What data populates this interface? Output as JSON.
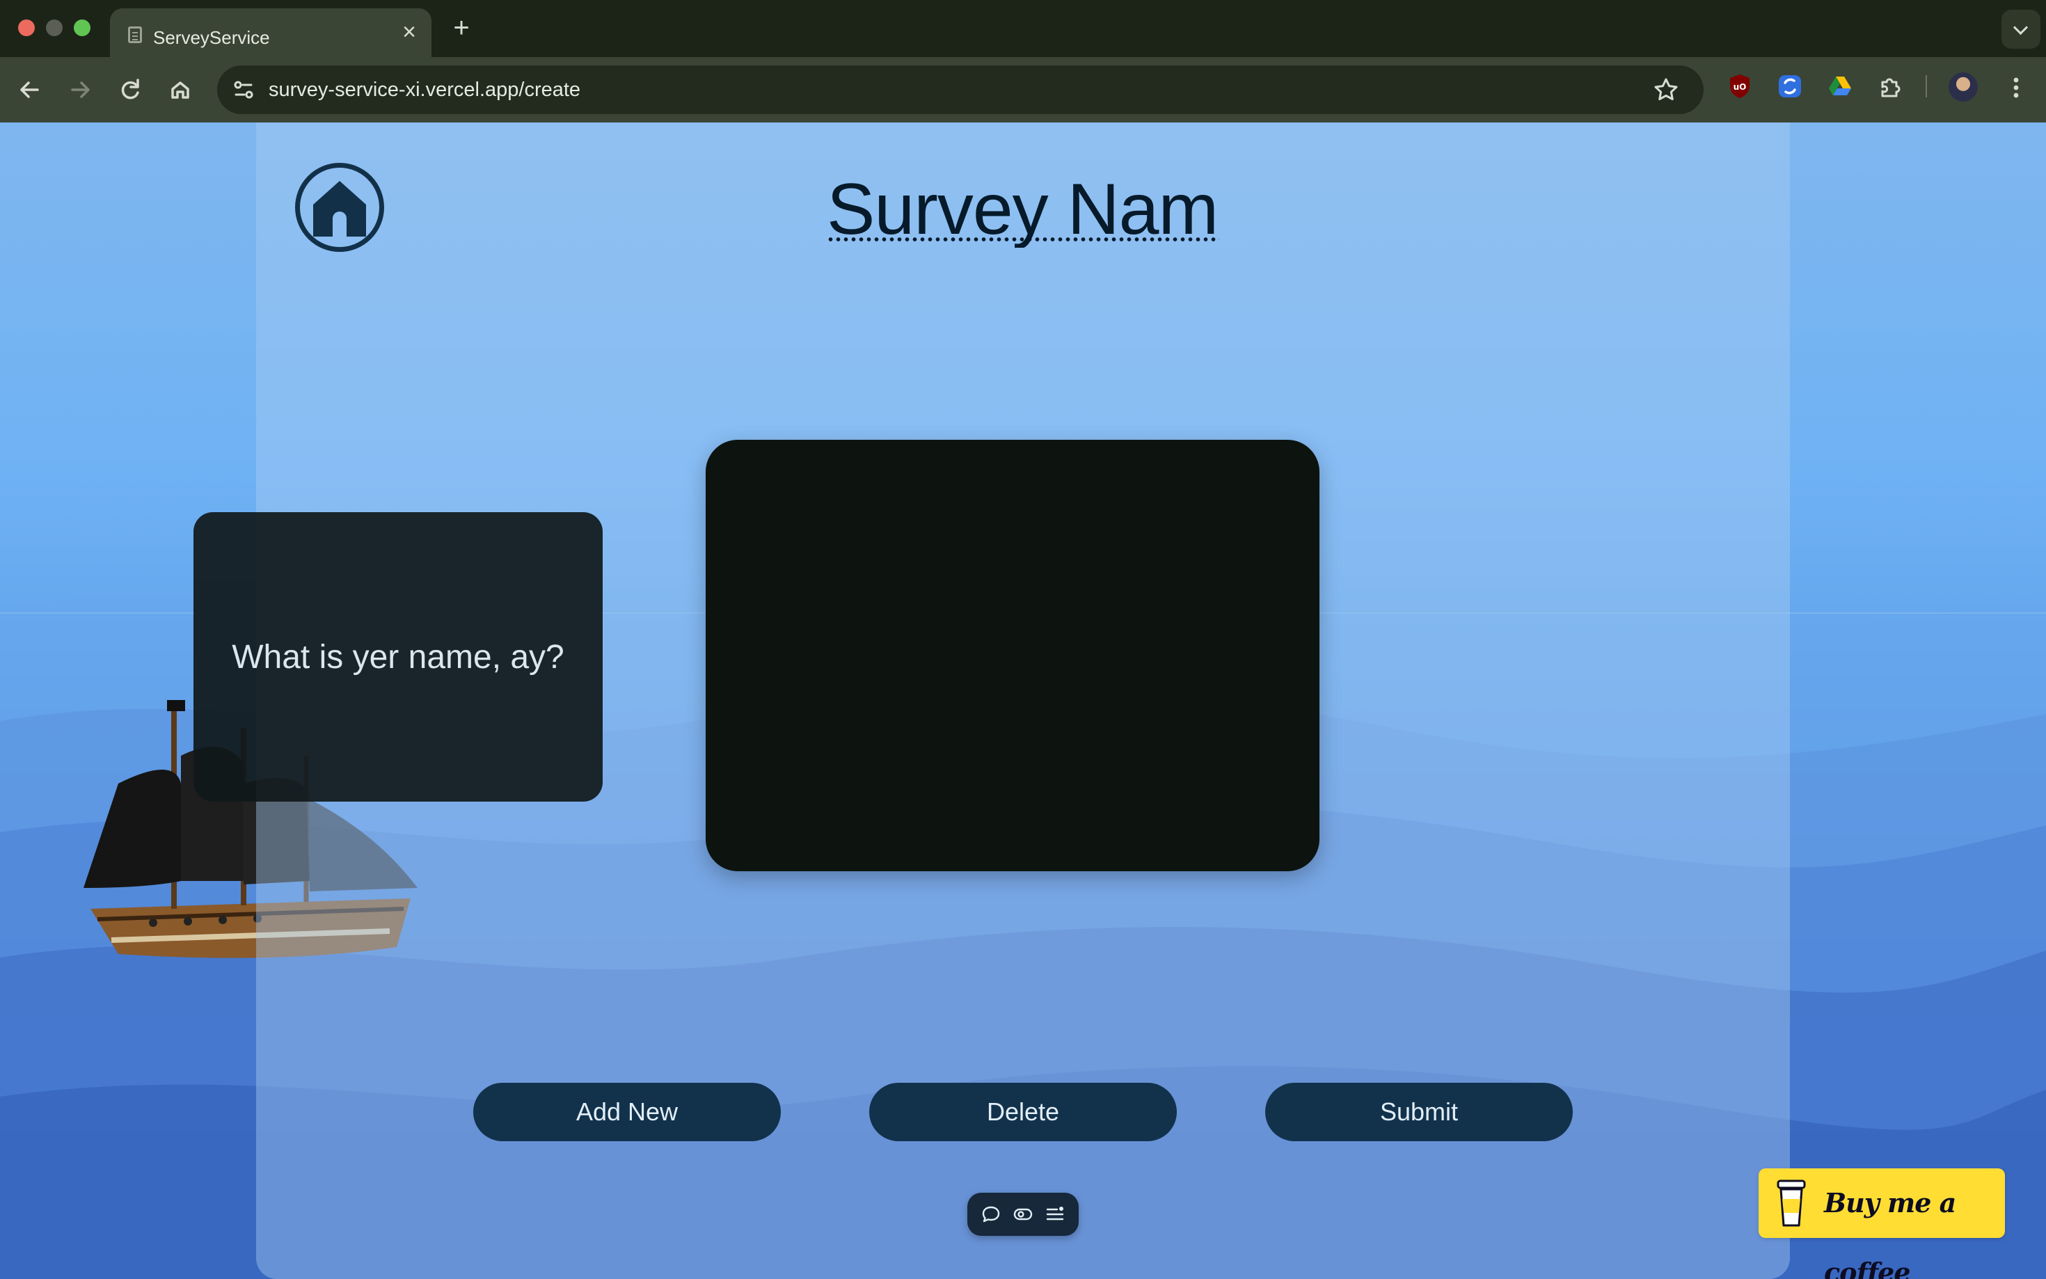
{
  "browser": {
    "tab_title": "ServeyService",
    "tab_close": "×",
    "new_tab": "+",
    "url": "survey-service-xi.vercel.app/create"
  },
  "page": {
    "survey_name": "Survey Name",
    "question_text": "What is yer name, ay?",
    "buttons": {
      "add_new": "Add New",
      "delete": "Delete",
      "submit": "Submit"
    },
    "mini_toolbar_icons": [
      "comment-icon",
      "view-icon",
      "list-settings-icon"
    ],
    "coffee_label": "Buy me a coffee"
  },
  "colors": {
    "browser_frame": "#1c2418",
    "toolbar": "#3b4535",
    "button_bg": "#12324c",
    "card_dark": "#0d130f",
    "coffee_yellow": "#ffdd33",
    "title_text": "#061a2a"
  }
}
